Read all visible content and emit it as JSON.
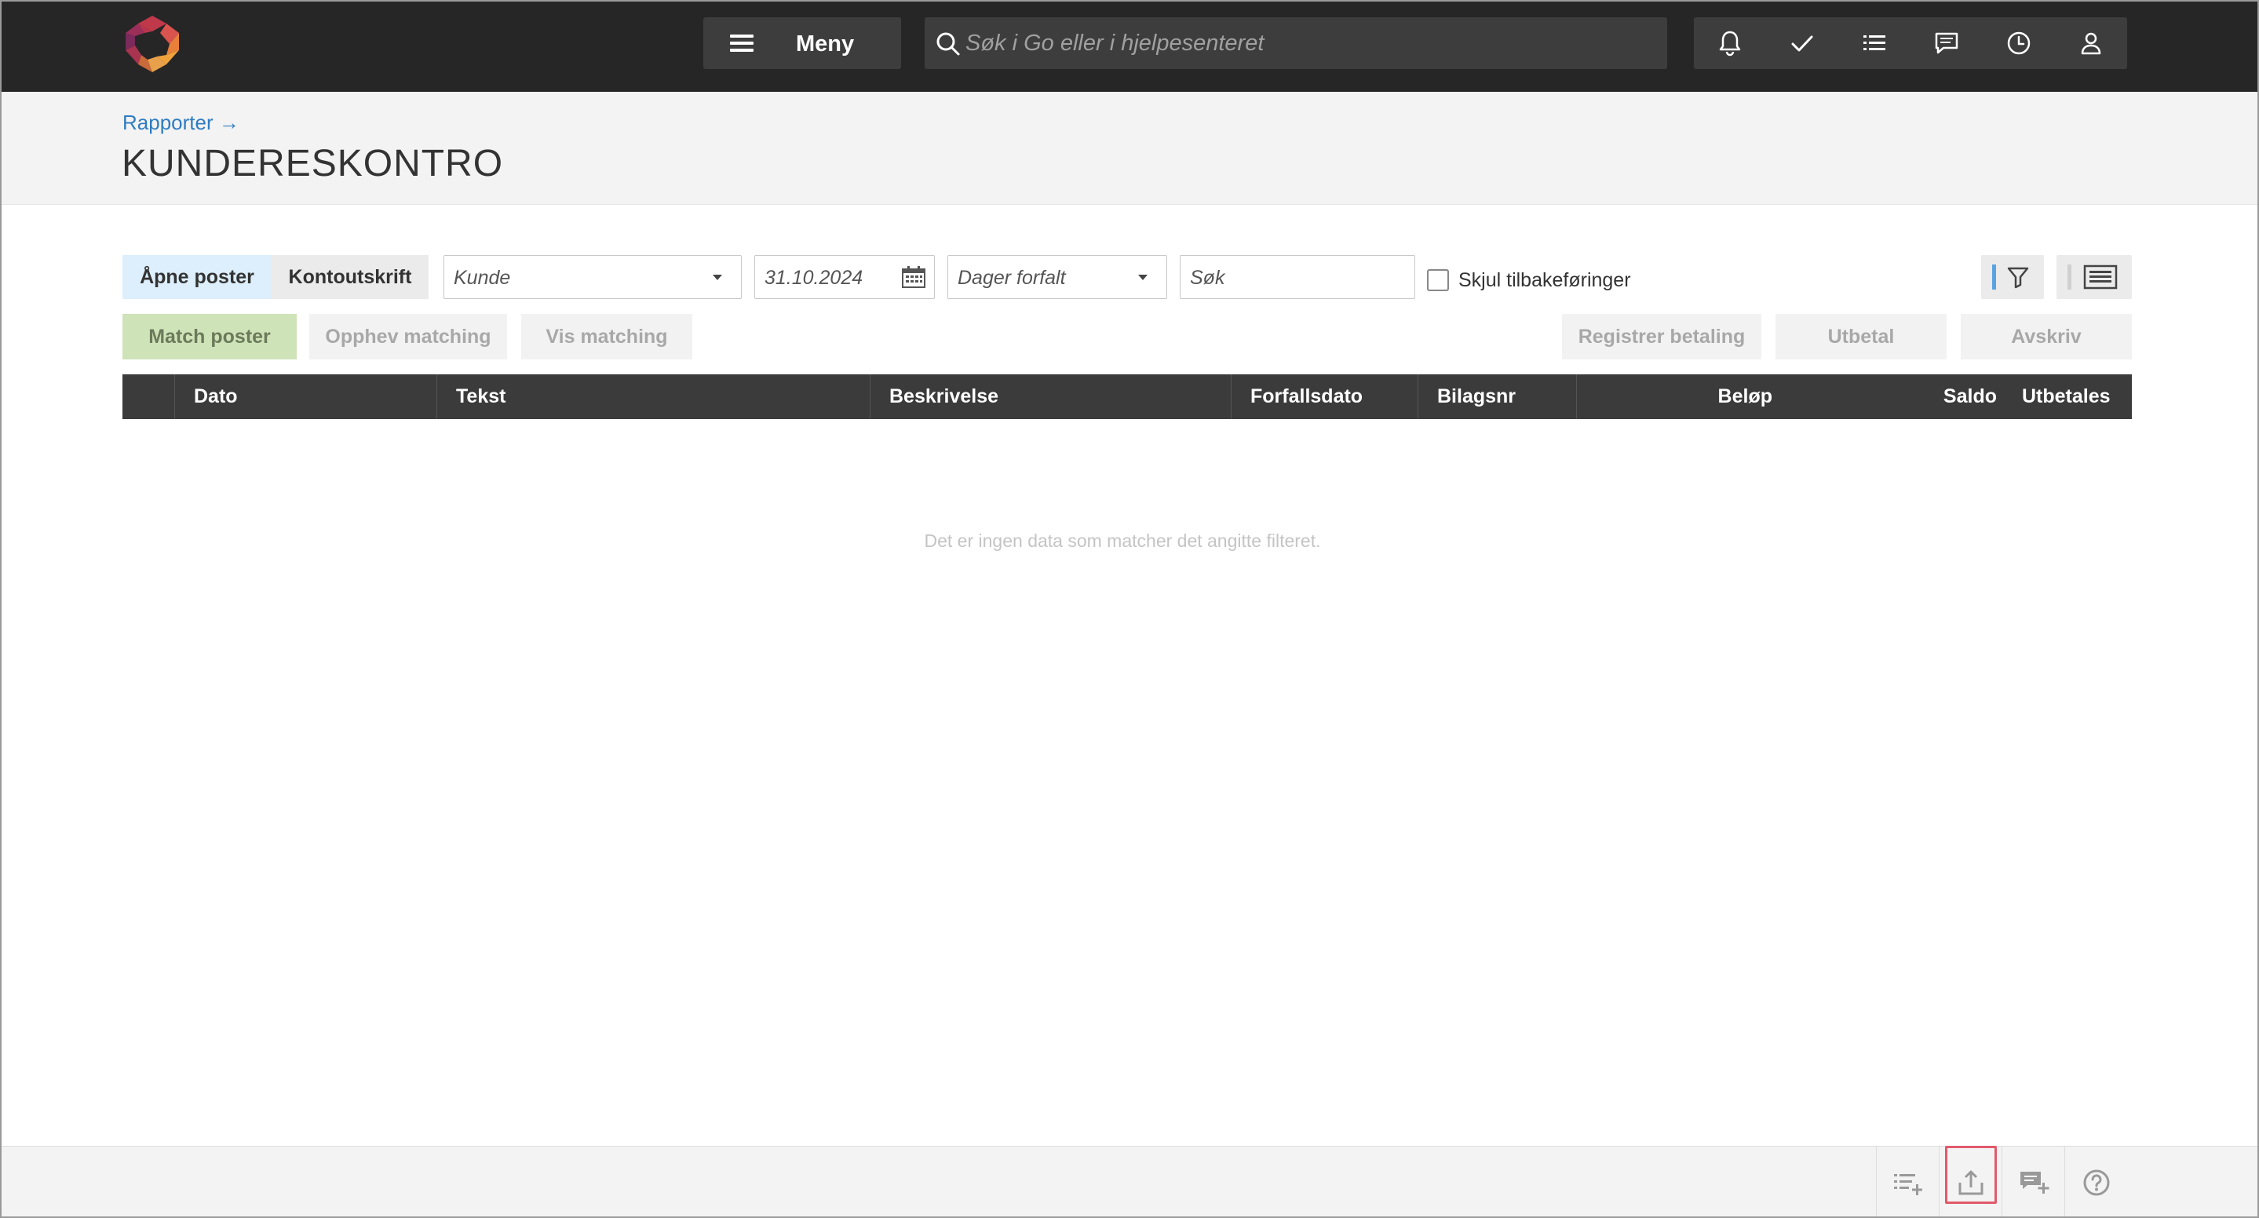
{
  "topbar": {
    "menu_label": "Meny",
    "search_placeholder": "Søk i Go eller i hjelpesenteret",
    "icons": [
      "bell-icon",
      "check-icon",
      "list-icon",
      "chat-icon",
      "clock-icon",
      "user-icon"
    ]
  },
  "header": {
    "breadcrumb": "Rapporter →",
    "title": "KUNDERESKONTRO"
  },
  "toolbar": {
    "tabs": [
      "Åpne poster",
      "Kontoutskrift"
    ],
    "active_tab": "Åpne poster",
    "customer_select": "Kunde",
    "date_value": "31.10.2024",
    "overdue_select": "Dager forfalt",
    "search_placeholder": "Søk",
    "hide_reversals_label": "Skjul tilbakeføringer",
    "hide_reversals_checked": false
  },
  "actions": {
    "match": "Match poster",
    "unmatch": "Opphev matching",
    "show_matching": "Vis matching",
    "register_payment": "Registrer betaling",
    "pay_out": "Utbetal",
    "write_off": "Avskriv"
  },
  "table": {
    "columns": [
      "Dato",
      "Tekst",
      "Beskrivelse",
      "Forfallsdato",
      "Bilagsnr",
      "Beløp",
      "Saldo",
      "Utbetales"
    ],
    "rows": [],
    "empty_message": "Det er ingen data som matcher det angitte filteret."
  },
  "bottombar": {
    "icons": [
      "add-list-icon",
      "export-icon",
      "add-comment-icon",
      "help-icon"
    ]
  },
  "colors": {
    "topbar": "#262626",
    "link": "#2f7cc1",
    "active_tab": "#ddeefc",
    "match_button": "#cfe3b8",
    "highlight": "#e05a6b"
  }
}
